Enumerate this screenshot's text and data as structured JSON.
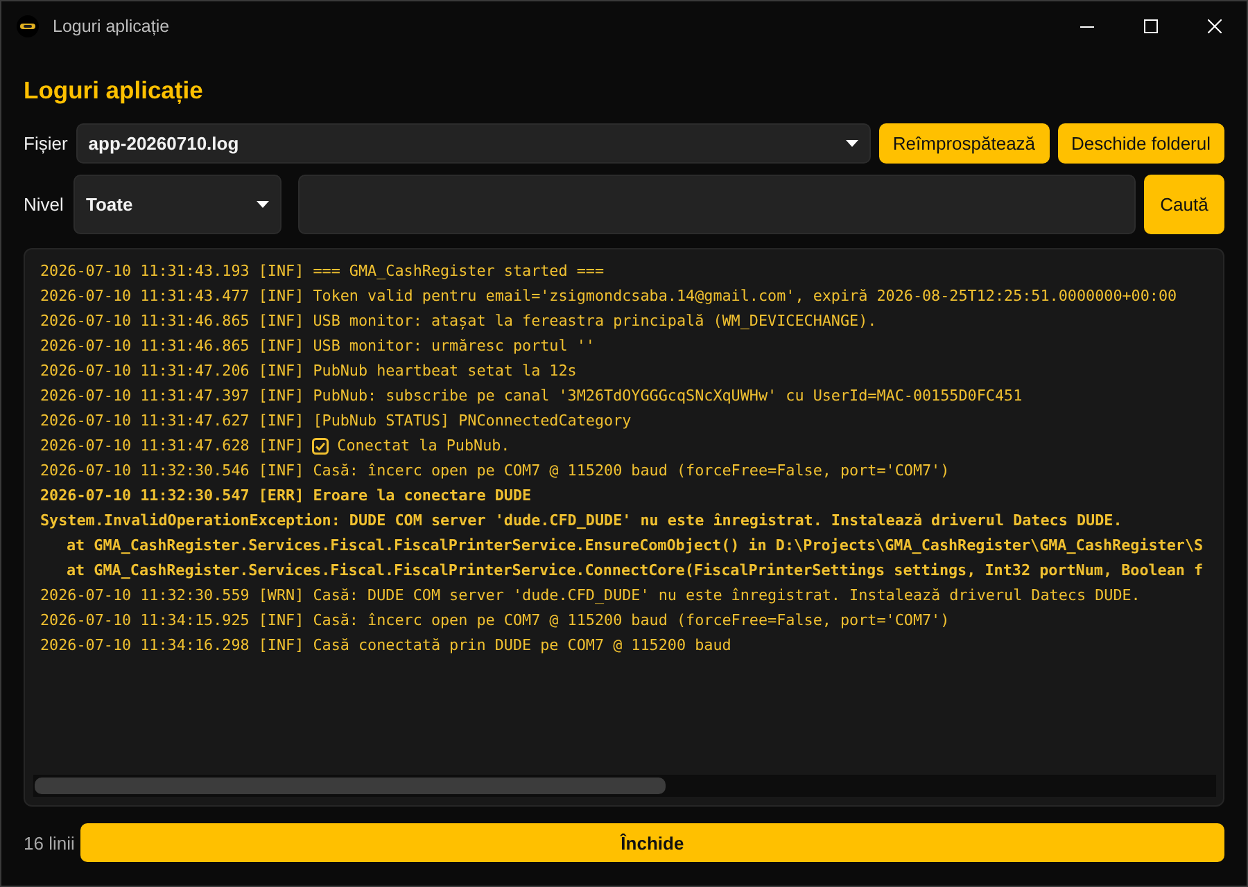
{
  "window": {
    "title": "Loguri aplicație"
  },
  "heading": "Loguri aplicație",
  "file_row": {
    "label": "Fișier",
    "value": "app-20260710.log",
    "buttons": [
      "Reîmprospătează",
      "Deschide folderul"
    ]
  },
  "filter_row": {
    "label": "Nivel",
    "value": "Toate",
    "search_button": "Caută"
  },
  "log": {
    "lines": [
      {
        "kind": "plain",
        "tick": false,
        "text": "2026-07-10 11:31:43.193 [INF] === GMA_CashRegister started ==="
      },
      {
        "kind": "plain",
        "tick": false,
        "text": "2026-07-10 11:31:43.477 [INF] Token valid pentru email='zsigmondcsaba.14@gmail.com', expiră 2026-08-25T12:25:51.0000000+00:00"
      },
      {
        "kind": "plain",
        "tick": false,
        "text": "2026-07-10 11:31:46.865 [INF] USB monitor: atașat la fereastra principală (WM_DEVICECHANGE)."
      },
      {
        "kind": "plain",
        "tick": false,
        "text": "2026-07-10 11:31:46.865 [INF] USB monitor: urmăresc portul ''"
      },
      {
        "kind": "plain",
        "tick": false,
        "text": "2026-07-10 11:31:47.206 [INF] PubNub heartbeat setat la 12s"
      },
      {
        "kind": "plain",
        "tick": false,
        "text": "2026-07-10 11:31:47.397 [INF] PubNub: subscribe pe canal '3M26TdOYGGGcqSNcXqUWHw' cu UserId=MAC-00155D0FC451"
      },
      {
        "kind": "plain",
        "tick": false,
        "text": "2026-07-10 11:31:47.627 [INF] [PubNub STATUS] PNConnectedCategory"
      },
      {
        "kind": "plain",
        "tick": true,
        "text": "2026-07-10 11:31:47.628 [INF]",
        "after": "Conectat la PubNub."
      },
      {
        "kind": "plain",
        "tick": false,
        "text": "2026-07-10 11:32:30.546 [INF] Casă: încerc open pe COM7 @ 115200 baud (forceFree=False, port='COM7')"
      },
      {
        "kind": "error",
        "tick": false,
        "text": "2026-07-10 11:32:30.547 [ERR] Eroare la conectare DUDE"
      },
      {
        "kind": "error",
        "tick": false,
        "text": "System.InvalidOperationException: DUDE COM server 'dude.CFD_DUDE' nu este înregistrat. Instalează driverul Datecs DUDE."
      },
      {
        "kind": "trace",
        "tick": false,
        "text": "at GMA_CashRegister.Services.Fiscal.FiscalPrinterService.EnsureComObject() in D:\\Projects\\GMA_CashRegister\\GMA_CashRegister\\S"
      },
      {
        "kind": "trace",
        "tick": false,
        "text": "at GMA_CashRegister.Services.Fiscal.FiscalPrinterService.ConnectCore(FiscalPrinterSettings settings, Int32 portNum, Boolean f"
      },
      {
        "kind": "plain",
        "tick": false,
        "text": "2026-07-10 11:32:30.559 [WRN] Casă: DUDE COM server 'dude.CFD_DUDE' nu este înregistrat. Instalează driverul Datecs DUDE."
      },
      {
        "kind": "plain",
        "tick": false,
        "text": "2026-07-10 11:34:15.925 [INF] Casă: încerc open pe COM7 @ 115200 baud (forceFree=False, port='COM7')"
      },
      {
        "kind": "plain",
        "tick": false,
        "text": "2026-07-10 11:34:16.298 [INF] Casă conectată prin DUDE pe COM7 @ 115200 baud"
      }
    ]
  },
  "footer": {
    "count": "16 linii",
    "close_button": "Închide"
  }
}
